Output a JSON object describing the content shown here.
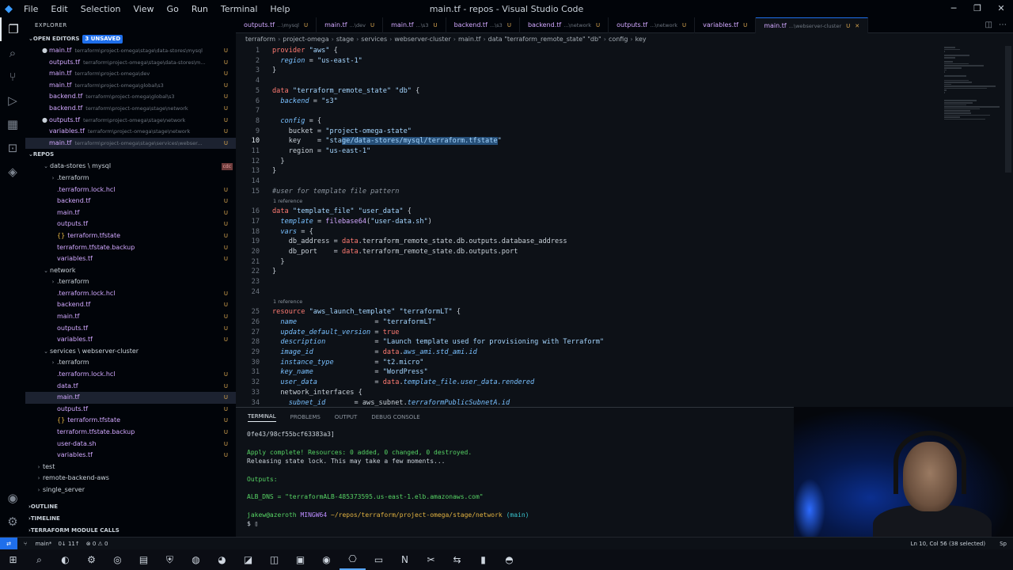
{
  "titlebar": {
    "menu": [
      "File",
      "Edit",
      "Selection",
      "View",
      "Go",
      "Run",
      "Terminal",
      "Help"
    ],
    "title": "main.tf - repos - Visual Studio Code"
  },
  "sidebar": {
    "header": "EXPLORER",
    "open_editors_label": "OPEN EDITORS",
    "unsaved_badge": "3 UNSAVED",
    "open_editors": [
      {
        "name": "main.tf",
        "path": "terraform\\project-omega\\stage\\data-stores\\mysql",
        "status": "U",
        "dirty": true
      },
      {
        "name": "outputs.tf",
        "path": "terraform\\project-omega\\stage\\data-stores\\m...",
        "status": "U",
        "dirty": false
      },
      {
        "name": "main.tf",
        "path": "terraform\\project-omega\\dev",
        "status": "U",
        "dirty": false
      },
      {
        "name": "main.tf",
        "path": "terraform\\project-omega\\global\\s3",
        "status": "U",
        "dirty": false
      },
      {
        "name": "backend.tf",
        "path": "terraform\\project-omega\\global\\s3",
        "status": "U",
        "dirty": false
      },
      {
        "name": "backend.tf",
        "path": "terraform\\project-omega\\stage\\network",
        "status": "U",
        "dirty": false
      },
      {
        "name": "outputs.tf",
        "path": "terraform\\project-omega\\stage\\network",
        "status": "U",
        "dirty": true
      },
      {
        "name": "variables.tf",
        "path": "terraform\\project-omega\\stage\\network",
        "status": "U",
        "dirty": false
      },
      {
        "name": "main.tf",
        "path": "terraform\\project-omega\\stage\\services\\webser...",
        "status": "U",
        "dirty": false
      }
    ],
    "repos_label": "REPOS",
    "tree": [
      {
        "label": "data-stores \\ mysql",
        "indent": 1,
        "type": "folder-open",
        "tag": "cdc"
      },
      {
        "label": ".terraform",
        "indent": 2,
        "type": "folder",
        "status": ""
      },
      {
        "label": ".terraform.lock.hcl",
        "indent": 2,
        "type": "file",
        "status": "U"
      },
      {
        "label": "backend.tf",
        "indent": 2,
        "type": "file",
        "status": "U"
      },
      {
        "label": "main.tf",
        "indent": 2,
        "type": "file",
        "status": "U"
      },
      {
        "label": "outputs.tf",
        "indent": 2,
        "type": "file",
        "status": "U"
      },
      {
        "label": "terraform.tfstate",
        "indent": 2,
        "type": "json",
        "status": "U"
      },
      {
        "label": "terraform.tfstate.backup",
        "indent": 2,
        "type": "file",
        "status": "U"
      },
      {
        "label": "variables.tf",
        "indent": 2,
        "type": "file",
        "status": "U"
      },
      {
        "label": "network",
        "indent": 1,
        "type": "folder-open",
        "status": ""
      },
      {
        "label": ".terraform",
        "indent": 2,
        "type": "folder",
        "status": ""
      },
      {
        "label": ".terraform.lock.hcl",
        "indent": 2,
        "type": "file",
        "status": "U"
      },
      {
        "label": "backend.tf",
        "indent": 2,
        "type": "file",
        "status": "U"
      },
      {
        "label": "main.tf",
        "indent": 2,
        "type": "file",
        "status": "U"
      },
      {
        "label": "outputs.tf",
        "indent": 2,
        "type": "file",
        "status": "U"
      },
      {
        "label": "variables.tf",
        "indent": 2,
        "type": "file",
        "status": "U"
      },
      {
        "label": "services \\ webserver-cluster",
        "indent": 1,
        "type": "folder-open",
        "status": ""
      },
      {
        "label": ".terraform",
        "indent": 2,
        "type": "folder",
        "status": ""
      },
      {
        "label": ".terraform.lock.hcl",
        "indent": 2,
        "type": "file",
        "status": "U"
      },
      {
        "label": "data.tf",
        "indent": 2,
        "type": "file",
        "status": "U"
      },
      {
        "label": "main.tf",
        "indent": 2,
        "type": "file",
        "status": "U",
        "selected": true
      },
      {
        "label": "outputs.tf",
        "indent": 2,
        "type": "file",
        "status": "U"
      },
      {
        "label": "terraform.tfstate",
        "indent": 2,
        "type": "json",
        "status": "U"
      },
      {
        "label": "terraform.tfstate.backup",
        "indent": 2,
        "type": "file",
        "status": "U"
      },
      {
        "label": "user-data.sh",
        "indent": 2,
        "type": "file",
        "status": "U"
      },
      {
        "label": "variables.tf",
        "indent": 2,
        "type": "file",
        "status": "U"
      },
      {
        "label": "test",
        "indent": 0,
        "type": "folder",
        "status": ""
      },
      {
        "label": "remote-backend-aws",
        "indent": 0,
        "type": "folder",
        "status": ""
      },
      {
        "label": "single_server",
        "indent": 0,
        "type": "folder",
        "status": ""
      }
    ],
    "outline_label": "OUTLINE",
    "timeline_label": "TIMELINE",
    "tf_module_label": "TERRAFORM MODULE CALLS"
  },
  "tabs": [
    {
      "name": "outputs.tf",
      "path": "...\\mysql",
      "status": "U",
      "active": false
    },
    {
      "name": "main.tf",
      "path": "...\\dev",
      "status": "U",
      "active": false
    },
    {
      "name": "main.tf",
      "path": "...\\s3",
      "status": "U",
      "active": false
    },
    {
      "name": "backend.tf",
      "path": "...\\s3",
      "status": "U",
      "active": false
    },
    {
      "name": "backend.tf",
      "path": "...\\network",
      "status": "U",
      "active": false
    },
    {
      "name": "outputs.tf",
      "path": "...\\network",
      "status": "U",
      "active": false
    },
    {
      "name": "variables.tf",
      "path": "",
      "status": "U",
      "active": false
    },
    {
      "name": "main.tf",
      "path": "...\\webserver-cluster",
      "status": "U",
      "active": true
    }
  ],
  "breadcrumb": [
    "terraform",
    "project-omega",
    "stage",
    "services",
    "webserver-cluster",
    "main.tf",
    "data \"terraform_remote_state\" \"db\"",
    "config",
    "key"
  ],
  "editor": {
    "current_line": 10,
    "lines": [
      {
        "n": 1,
        "html": "<span class=\"k\">provider</span> <span class=\"s\">\"aws\"</span> {"
      },
      {
        "n": 2,
        "html": "  <span class=\"p\">region</span> = <span class=\"s\">\"us-east-1\"</span>"
      },
      {
        "n": 3,
        "html": "}"
      },
      {
        "n": 4,
        "html": ""
      },
      {
        "n": 5,
        "html": "<span class=\"k\">data</span> <span class=\"s\">\"terraform_remote_state\"</span> <span class=\"s\">\"db\"</span> {"
      },
      {
        "n": 6,
        "html": "  <span class=\"p\">backend</span> = <span class=\"s\">\"s3\"</span>"
      },
      {
        "n": 7,
        "html": ""
      },
      {
        "n": 8,
        "html": "  <span class=\"p\">config</span> = {"
      },
      {
        "n": 9,
        "html": "    bucket = <span class=\"s\">\"project-omega-state\"</span>"
      },
      {
        "n": 10,
        "html": "    key    = <span class=\"s\">\"sta<span class=\"hl\">ge/data-stores/mysql/terraform.tfstate</span>\"</span>"
      },
      {
        "n": 11,
        "html": "    region = <span class=\"s\">\"us-east-1\"</span>"
      },
      {
        "n": 12,
        "html": "  }"
      },
      {
        "n": 13,
        "html": "}"
      },
      {
        "n": 14,
        "html": ""
      },
      {
        "n": 15,
        "html": "<span class=\"c\">#user for template file pattern</span>"
      },
      {
        "ref": "1 reference"
      },
      {
        "n": 16,
        "html": "<span class=\"k\">data</span> <span class=\"s\">\"template_file\"</span> <span class=\"s\">\"user_data\"</span> {"
      },
      {
        "n": 17,
        "html": "  <span class=\"p\">template</span> = <span class=\"f\">filebase64</span>(<span class=\"s\">\"user-data.sh\"</span>)"
      },
      {
        "n": 18,
        "html": "  <span class=\"p\">vars</span> = {"
      },
      {
        "n": 19,
        "html": "    db_address = <span class=\"k\">data</span>.terraform_remote_state.db.outputs.database_address"
      },
      {
        "n": 20,
        "html": "    db_port    = <span class=\"k\">data</span>.terraform_remote_state.db.outputs.port"
      },
      {
        "n": 21,
        "html": "  }"
      },
      {
        "n": 22,
        "html": "}"
      },
      {
        "n": 23,
        "html": ""
      },
      {
        "n": 24,
        "html": ""
      },
      {
        "ref": "1 reference"
      },
      {
        "n": 25,
        "html": "<span class=\"k\">resource</span> <span class=\"s\">\"aws_launch_template\"</span> <span class=\"s\">\"terraformLT\"</span> {"
      },
      {
        "n": 26,
        "html": "  <span class=\"p\">name</span>                   = <span class=\"s\">\"terraformLT\"</span>"
      },
      {
        "n": 27,
        "html": "  <span class=\"p\">update_default_version</span> = <span class=\"k\">true</span>"
      },
      {
        "n": 28,
        "html": "  <span class=\"p\">description</span>            = <span class=\"s\">\"Launch template used for provisioning with Terraform\"</span>"
      },
      {
        "n": 29,
        "html": "  <span class=\"p\">image_id</span>               = <span class=\"k\">data</span>.<span class=\"p\">aws_ami.std_ami.id</span>"
      },
      {
        "n": 30,
        "html": "  <span class=\"p\">instance_type</span>          = <span class=\"s\">\"t2.micro\"</span>"
      },
      {
        "n": 31,
        "html": "  <span class=\"p\">key_name</span>               = <span class=\"s\">\"WordPress\"</span>"
      },
      {
        "n": 32,
        "html": "  <span class=\"p\">user_data</span>              = <span class=\"k\">data</span>.<span class=\"p\">template_file.user_data.rendered</span>"
      },
      {
        "n": 33,
        "html": "  network_interfaces {"
      },
      {
        "n": 34,
        "html": "    <span class=\"p\">subnet_id</span>       = aws_subnet.<span class=\"p\">terraformPublicSubnetA.id</span>"
      }
    ]
  },
  "panel": {
    "tabs": [
      "TERMINAL",
      "PROBLEMS",
      "OUTPUT",
      "DEBUG CONSOLE"
    ],
    "active_tab": "TERMINAL",
    "lines": [
      {
        "text": "0fe43/98cf55bcf63383a3]",
        "cls": ""
      },
      {
        "text": "",
        "cls": ""
      },
      {
        "text": "Apply complete! Resources: 0 added, 0 changed, 0 destroyed.",
        "cls": "green"
      },
      {
        "text": "Releasing state lock. This may take a few moments...",
        "cls": ""
      },
      {
        "text": "",
        "cls": ""
      },
      {
        "text": "Outputs:",
        "cls": "green"
      },
      {
        "text": "",
        "cls": ""
      },
      {
        "text": "ALB_DNS = \"terraformALB-485373595.us-east-1.elb.amazonaws.com\"",
        "cls": "green"
      },
      {
        "text": "",
        "cls": ""
      }
    ],
    "prompt": {
      "user": "jakew@azeroth",
      "shell": "MINGW64",
      "dir": "~/repos/terraform/project-omega/stage/network",
      "branch": "(main)",
      "symbol": "$"
    }
  },
  "statusbar": {
    "branch": "main*",
    "sync": "0↓ 11↑",
    "problems": "⊗ 0  ⚠ 0",
    "position": "Ln 10, Col 56 (38 selected)",
    "spaces": "Sp"
  },
  "taskbar_icons": [
    "windows-icon",
    "search-icon",
    "discord-icon",
    "settings-icon",
    "obs-icon",
    "files-icon",
    "bitwarden-icon",
    "firefox-icon",
    "chrome-icon",
    "outlook-icon",
    "teams-icon",
    "zoom-icon",
    "spotify-icon",
    "vscode-icon",
    "terminal-icon",
    "onenote-icon",
    "snipping-icon",
    "remote-icon",
    "twitch-icon",
    "edge-icon"
  ]
}
